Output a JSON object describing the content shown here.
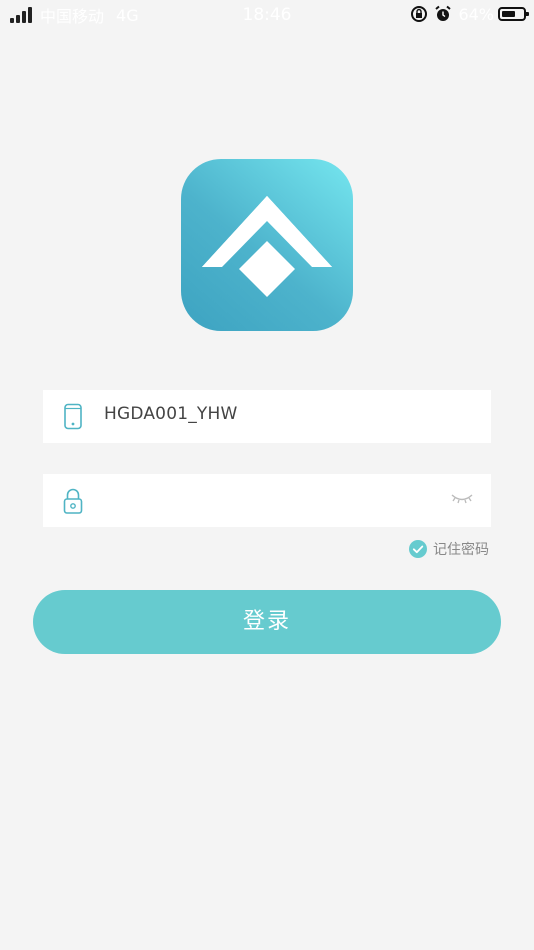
{
  "status_bar": {
    "carrier": "中国移动",
    "network": "4G",
    "time": "18:46",
    "battery_percent": "64%",
    "battery_level": 0.64
  },
  "logo": {
    "icon": "app-logo-house",
    "gradient": [
      "#3da3c1",
      "#75e6ef"
    ]
  },
  "login": {
    "username_value": "HGDA001_YHW",
    "username_icon": "phone-icon",
    "password_value": "",
    "password_icon": "lock-icon",
    "password_toggle_icon": "eye-closed-icon",
    "remember_label": "记住密码",
    "remember_checked": true,
    "submit_label": "登录",
    "accent_color": "#66cbcf"
  }
}
